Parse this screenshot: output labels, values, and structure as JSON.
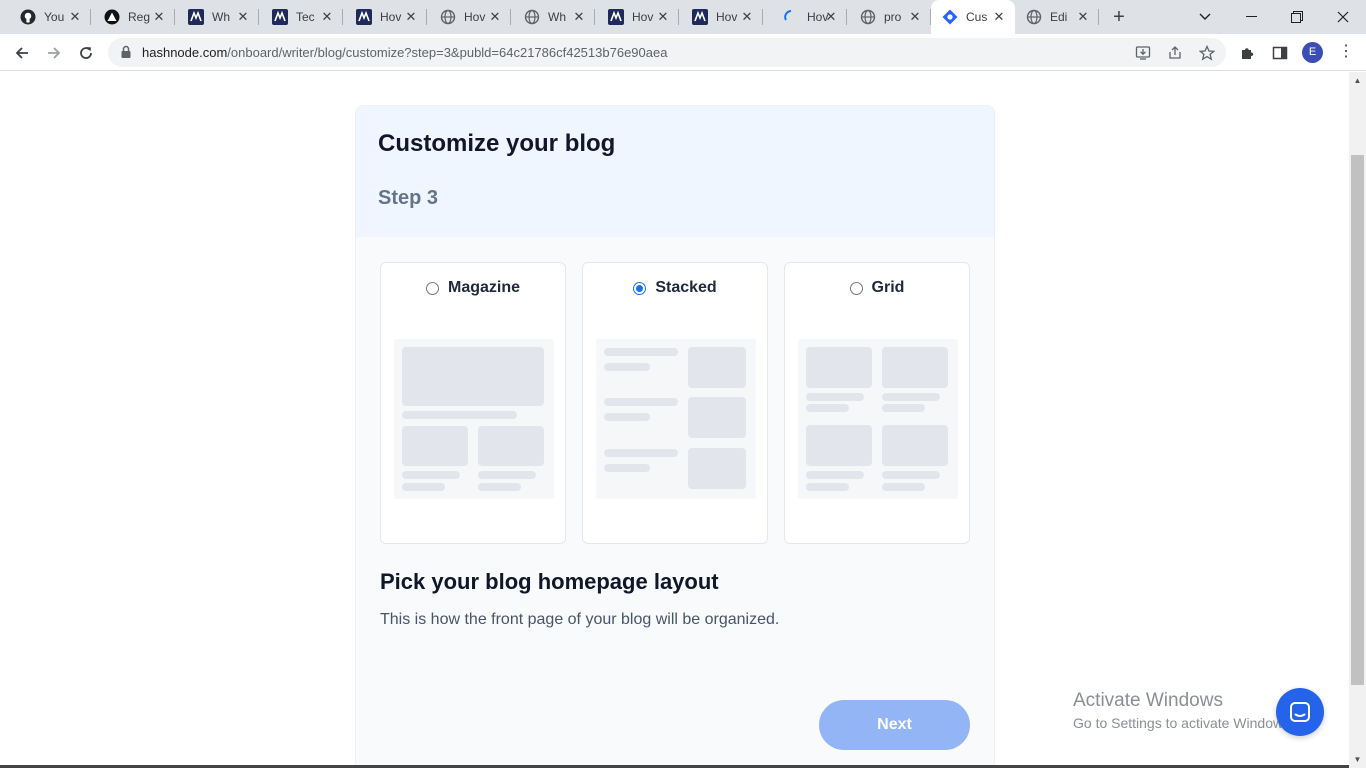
{
  "browser": {
    "tabs": [
      {
        "title": "You",
        "icon": "github-icon",
        "active": false
      },
      {
        "title": "Reg",
        "icon": "triangle-logo-icon",
        "active": false
      },
      {
        "title": "Wh",
        "icon": "hashnode-dark-icon",
        "active": false
      },
      {
        "title": "Tec",
        "icon": "hashnode-dark-icon",
        "active": false
      },
      {
        "title": "Hov",
        "icon": "hashnode-dark-icon",
        "active": false
      },
      {
        "title": "Hov",
        "icon": "globe-icon",
        "active": false
      },
      {
        "title": "Wh",
        "icon": "globe-icon",
        "active": false
      },
      {
        "title": "Hov",
        "icon": "hashnode-dark-icon",
        "active": false
      },
      {
        "title": "Hov",
        "icon": "hashnode-dark-icon",
        "active": false
      },
      {
        "title": "Hov",
        "icon": "loading-icon",
        "active": false
      },
      {
        "title": "pro",
        "icon": "globe-icon",
        "active": false
      },
      {
        "title": "Cus",
        "icon": "hashnode-blue-icon",
        "active": true
      },
      {
        "title": "Edi",
        "icon": "globe-icon",
        "active": false
      }
    ],
    "url": {
      "host": "hashnode.com",
      "path": "/onboard/writer/blog/customize?step=3&publd=64c21786cf42513b76e90aea"
    },
    "profile_initial": "E"
  },
  "page": {
    "title": "Customize your blog",
    "step": "Step 3",
    "layouts": [
      {
        "label": "Magazine",
        "selected": false
      },
      {
        "label": "Stacked",
        "selected": true
      },
      {
        "label": "Grid",
        "selected": false
      }
    ],
    "heading": "Pick your blog homepage layout",
    "description": "This is how the front page of your blog will be organized.",
    "next_label": "Next"
  },
  "overlay": {
    "watermark_line1": "Activate Windows",
    "watermark_line2": "Go to Settings to activate Windows."
  },
  "colors": {
    "accent": "#1a73e8",
    "next_button": "#93b4f5",
    "header_bg": "#eff6ff",
    "chat_button": "#2563eb"
  }
}
